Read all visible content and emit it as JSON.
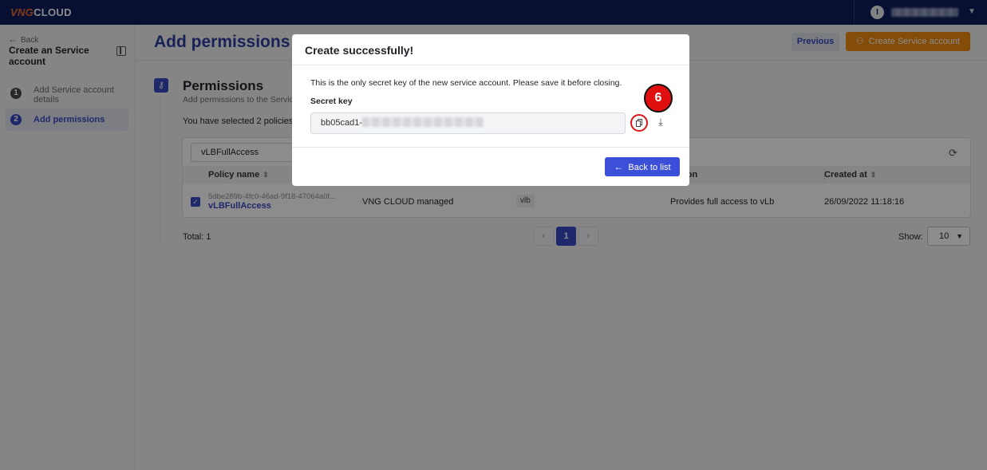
{
  "topbar": {
    "logo_part1": "VNG",
    "logo_part2": "CLOUD",
    "user_initial": "I"
  },
  "sidebar": {
    "back_label": "Back",
    "title": "Create an Service account",
    "steps": [
      {
        "num": "1",
        "label": "Add Service account details"
      },
      {
        "num": "2",
        "label": "Add permissions"
      }
    ]
  },
  "header": {
    "title": "Add permissions",
    "previous_label": "Previous",
    "create_label": "Create Service account"
  },
  "permissions": {
    "title": "Permissions",
    "subtitle": "Add permissions to the Service",
    "selected_text": "You have selected 2 policies.",
    "filter_value": "vLBFullAccess",
    "columns": [
      "Policy name",
      "ription",
      "Created at"
    ],
    "rows": [
      {
        "id": "5dbe289b-4fc0-46ad-9f18-47064a0f...",
        "name": "vLBFullAccess",
        "type": "VNG CLOUD managed",
        "tag": "vlb",
        "description": "Provides full access to vLb",
        "created_at": "26/09/2022 11:18:16"
      }
    ],
    "total": "Total: 1",
    "page": "1",
    "show_label": "Show:",
    "show_value": "10"
  },
  "modal": {
    "title": "Create successfully!",
    "message": "This is the only secret key of the new service account. Please save it before closing.",
    "secret_label": "Secret key",
    "secret_prefix": "bb05cad1-",
    "back_label": "Back to list",
    "badge": "6"
  },
  "colors": {
    "topbar": "#0d1e5e",
    "primary": "#3949c4",
    "accent": "#ee8a12",
    "highlight": "#e01515"
  },
  "icons": [
    "user-avatar-icon",
    "caret-down-icon",
    "arrow-left-icon",
    "collapse-icon",
    "key-icon",
    "refresh-icon",
    "sort-icon",
    "checkbox-checked-icon",
    "copy-icon",
    "download-icon",
    "user-add-icon"
  ]
}
